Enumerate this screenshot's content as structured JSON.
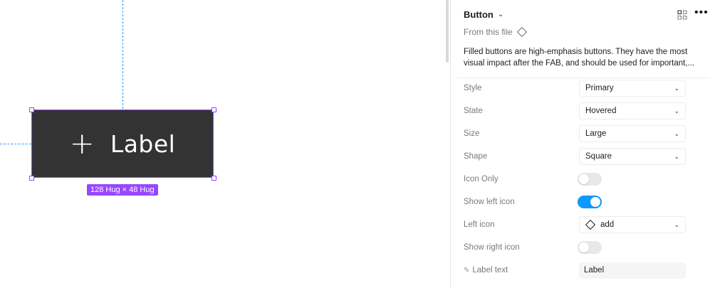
{
  "canvas": {
    "button_preview": {
      "icon": "+",
      "label": "Label"
    },
    "dimension_badge": "128 Hug × 48 Hug"
  },
  "panel": {
    "title": "Button",
    "title_chevron": "⌄",
    "more_icon": "•••",
    "from_file": "From this file",
    "description": "Filled buttons are high-emphasis buttons. They have the most visual impact after the FAB, and should be used for important,...",
    "properties": {
      "style": {
        "label": "Style",
        "value": "Primary"
      },
      "state": {
        "label": "State",
        "value": "Hovered"
      },
      "size": {
        "label": "Size",
        "value": "Large"
      },
      "shape": {
        "label": "Shape",
        "value": "Square"
      },
      "icon_only": {
        "label": "Icon Only",
        "on": false
      },
      "show_left_icon": {
        "label": "Show left icon",
        "on": true
      },
      "left_icon": {
        "label": "Left icon",
        "value": "add"
      },
      "show_right_icon": {
        "label": "Show right icon",
        "on": false
      },
      "label_text": {
        "label": "Label text",
        "value": "Label"
      }
    },
    "colors": {
      "toggle_on": "#0d99ff",
      "selection": "#9747ff",
      "button_fill": "#333333"
    }
  }
}
